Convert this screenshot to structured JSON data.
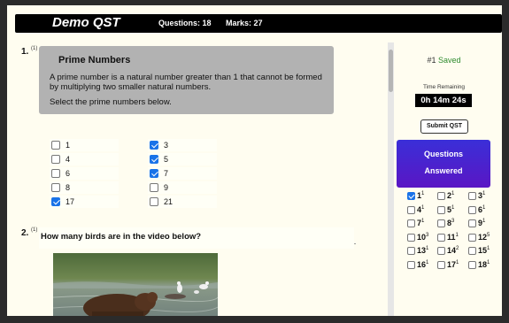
{
  "header": {
    "title": "Demo QST",
    "questions": "Questions: 18",
    "marks": "Marks: 27"
  },
  "q1": {
    "number": "1.",
    "marks": "(1)",
    "heading": "Prime Numbers",
    "text": "A prime number is a natural number greater than 1 that cannot be formed by multiplying two smaller natural numbers.",
    "instruction": "Select the prime numbers below.",
    "options": [
      {
        "label": "1",
        "checked": false
      },
      {
        "label": "3",
        "checked": true
      },
      {
        "label": "4",
        "checked": false
      },
      {
        "label": "5",
        "checked": true
      },
      {
        "label": "6",
        "checked": false
      },
      {
        "label": "7",
        "checked": true
      },
      {
        "label": "8",
        "checked": false
      },
      {
        "label": "9",
        "checked": false
      },
      {
        "label": "17",
        "checked": true
      },
      {
        "label": "21",
        "checked": false
      }
    ]
  },
  "q2": {
    "number": "2.",
    "marks": "(1)",
    "text": "How many birds are in the video below?"
  },
  "sidebar": {
    "saved_num": "#1",
    "saved_status": "Saved",
    "time_label": "Time Remaining",
    "timer": "0h 14m 24s",
    "submit": "Submit QST",
    "qa_line1": "Questions",
    "qa_line2": "Answered",
    "grid": [
      {
        "n": "1",
        "s": "1",
        "checked": true
      },
      {
        "n": "2",
        "s": "1",
        "checked": false
      },
      {
        "n": "3",
        "s": "1",
        "checked": false
      },
      {
        "n": "4",
        "s": "1",
        "checked": false
      },
      {
        "n": "5",
        "s": "1",
        "checked": false
      },
      {
        "n": "6",
        "s": "1",
        "checked": false
      },
      {
        "n": "7",
        "s": "1",
        "checked": false
      },
      {
        "n": "8",
        "s": "3",
        "checked": false
      },
      {
        "n": "9",
        "s": "1",
        "checked": false
      },
      {
        "n": "10",
        "s": "3",
        "checked": false
      },
      {
        "n": "11",
        "s": "1",
        "checked": false
      },
      {
        "n": "12",
        "s": "5",
        "checked": false
      },
      {
        "n": "13",
        "s": "1",
        "checked": false
      },
      {
        "n": "14",
        "s": "2",
        "checked": false
      },
      {
        "n": "15",
        "s": "1",
        "checked": false
      },
      {
        "n": "16",
        "s": "1",
        "checked": false
      },
      {
        "n": "17",
        "s": "1",
        "checked": false
      },
      {
        "n": "18",
        "s": "1",
        "checked": false
      }
    ]
  },
  "colors": {
    "checkbox_on": "#1a73e8",
    "saved": "#2e8b2e",
    "qa_panel": "#4a22d0"
  }
}
